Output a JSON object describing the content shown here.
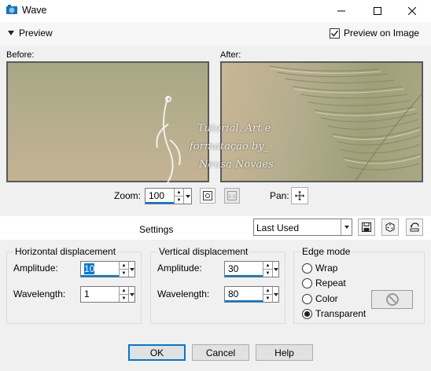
{
  "window": {
    "title": "Wave",
    "minimize_icon": "minimize-icon",
    "maximize_icon": "maximize-icon",
    "close_icon": "close-icon"
  },
  "preview": {
    "toggle_label": "Preview",
    "preview_on_image_label": "Preview on Image",
    "preview_on_image_checked": true,
    "before_label": "Before:",
    "after_label": "After:"
  },
  "watermark": {
    "line1": "Tutorial, Art e",
    "line2": "formatação by_",
    "line3": "Neusa Novaes"
  },
  "zoom": {
    "label": "Zoom:",
    "value": "100",
    "pan_label": "Pan:"
  },
  "settings": {
    "label": "Settings",
    "preset_value": "Last Used"
  },
  "horizontal": {
    "title": "Horizontal displacement",
    "amplitude_label": "Amplitude:",
    "amplitude_value": "10",
    "wavelength_label": "Wavelength:",
    "wavelength_value": "1"
  },
  "vertical": {
    "title": "Vertical displacement",
    "amplitude_label": "Amplitude:",
    "amplitude_value": "30",
    "wavelength_label": "Wavelength:",
    "wavelength_value": "80"
  },
  "edge_mode": {
    "title": "Edge mode",
    "options": [
      "Wrap",
      "Repeat",
      "Color",
      "Transparent"
    ],
    "selected": "Transparent"
  },
  "buttons": {
    "ok": "OK",
    "cancel": "Cancel",
    "help": "Help"
  },
  "colors": {
    "accent": "#0078d7"
  }
}
